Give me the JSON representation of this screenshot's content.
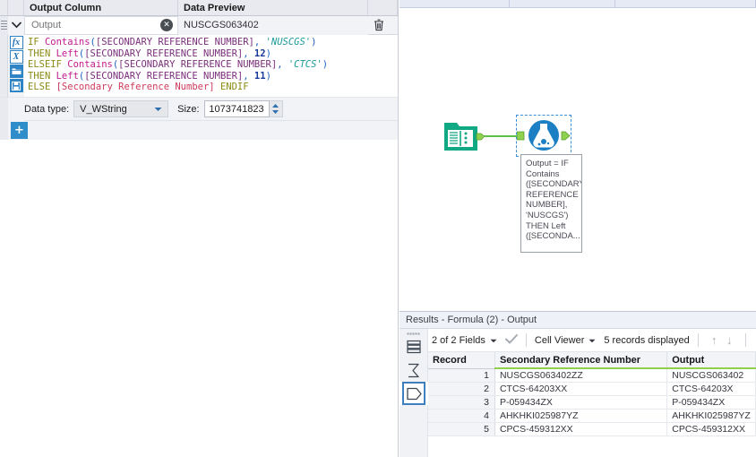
{
  "config": {
    "headers": {
      "output_column": "Output Column",
      "data_preview": "Data Preview"
    },
    "output_field": {
      "placeholder": "Output",
      "value": ""
    },
    "preview_value": "NUSCGS063402",
    "tools": [
      {
        "name": "function-icon",
        "glyph": "fx"
      },
      {
        "name": "variable-icon",
        "glyph": "X"
      },
      {
        "name": "open-folder-icon",
        "glyph": ""
      },
      {
        "name": "save-icon",
        "glyph": ""
      }
    ],
    "formula": {
      "lines": [
        [
          {
            "t": "IF ",
            "c": "k-if"
          },
          {
            "t": "Contains",
            "c": "k-fn"
          },
          {
            "t": "(",
            "c": "k-par"
          },
          {
            "t": "[SECONDARY REFERENCE NUMBER]",
            "c": "k-fld"
          },
          {
            "t": ", ",
            "c": "k-par"
          },
          {
            "t": "'NUSCGS'",
            "c": "k-str"
          },
          {
            "t": ")",
            "c": "k-par"
          }
        ],
        [
          {
            "t": "THEN ",
            "c": "k-if"
          },
          {
            "t": "Left",
            "c": "k-fn"
          },
          {
            "t": "(",
            "c": "k-par"
          },
          {
            "t": "[SECONDARY REFERENCE NUMBER]",
            "c": "k-fld"
          },
          {
            "t": ", ",
            "c": "k-par"
          },
          {
            "t": "12",
            "c": "k-num"
          },
          {
            "t": ")",
            "c": "k-par"
          }
        ],
        [
          {
            "t": "ELSEIF ",
            "c": "k-if"
          },
          {
            "t": "Contains",
            "c": "k-fn"
          },
          {
            "t": "(",
            "c": "k-par"
          },
          {
            "t": "[SECONDARY REFERENCE NUMBER]",
            "c": "k-fld"
          },
          {
            "t": ", ",
            "c": "k-par"
          },
          {
            "t": "'CTCS'",
            "c": "k-str"
          },
          {
            "t": ")",
            "c": "k-par"
          }
        ],
        [
          {
            "t": "THEN ",
            "c": "k-if"
          },
          {
            "t": "Left",
            "c": "k-fn"
          },
          {
            "t": "(",
            "c": "k-par"
          },
          {
            "t": "[SECONDARY REFERENCE NUMBER]",
            "c": "k-fld"
          },
          {
            "t": ", ",
            "c": "k-par"
          },
          {
            "t": "11",
            "c": "k-num"
          },
          {
            "t": ")",
            "c": "k-par"
          }
        ],
        [
          {
            "t": "ELSE ",
            "c": "k-if"
          },
          {
            "t": "[Secondary Reference Number]",
            "c": "k-plain"
          },
          {
            "t": " ENDIF",
            "c": "k-if"
          }
        ]
      ]
    },
    "data_type": {
      "label": "Data type:",
      "value": "V_WString"
    },
    "size": {
      "label": "Size:",
      "value": "1073741823"
    },
    "add_label": "+"
  },
  "canvas": {
    "input_node": {
      "name": "input-data-tool",
      "color": "#11a884"
    },
    "formula_node": {
      "name": "formula-tool",
      "color": "#1c7fc4"
    },
    "tooltip_text": "Output = IF Contains ([SECONDARY REFERENCE NUMBER], 'NUSCGS') THEN Left ([SECONDA..."
  },
  "results": {
    "title": "Results - Formula (2) - Output",
    "toolbar": {
      "fields": "2 of 2 Fields",
      "viewer": "Cell Viewer",
      "records": "5 records displayed"
    },
    "columns": [
      "Record",
      "Secondary Reference Number",
      "Output"
    ],
    "rows": [
      {
        "record": "1",
        "srn": "NUSCGS063402ZZ",
        "output": "NUSCGS063402"
      },
      {
        "record": "2",
        "srn": "CTCS-64203XX",
        "output": "CTCS-64203X"
      },
      {
        "record": "3",
        "srn": "P-059434ZX",
        "output": "P-059434ZX"
      },
      {
        "record": "4",
        "srn": "AHKHKI025987YZ",
        "output": "AHKHKI025987YZ"
      },
      {
        "record": "5",
        "srn": "CPCS-459312XX",
        "output": "CPCS-459312XX"
      }
    ]
  },
  "colors": {
    "accent_blue": "#2f8ec9",
    "node_green": "#11a884",
    "node_blue": "#1c7fc4",
    "header_underline": "#8fd14f"
  }
}
